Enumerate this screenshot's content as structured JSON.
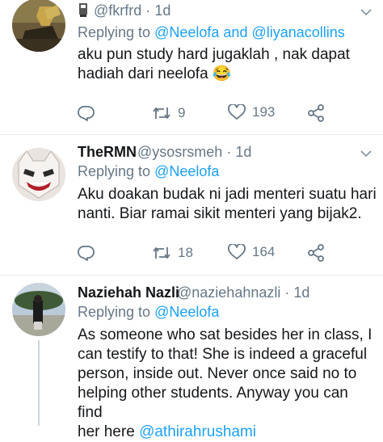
{
  "tweets": [
    {
      "name": "",
      "handle": "@fkrfrd",
      "time": "1d",
      "replying_prefix": "Replying to",
      "replying_mentions": [
        "@Neelofa",
        "@liyanacollins"
      ],
      "replying_joiner": "and",
      "body_lines": [
        "aku pun study hard jugaklah , nak dapat",
        "hadiah dari neelofa"
      ],
      "emoji": "😂",
      "replies": "",
      "retweets": "9",
      "likes": "193"
    },
    {
      "name": "TheRMN",
      "handle": "@ysosrsmeh",
      "time": "1d",
      "replying_prefix": "Replying to",
      "replying_mentions": [
        "@Neelofa"
      ],
      "body_lines": [
        "Aku doakan budak ni jadi menteri suatu hari",
        "nanti. Biar ramai sikit menteri yang bijak2."
      ],
      "replies": "",
      "retweets": "18",
      "likes": "164"
    },
    {
      "name": "Naziehah Nazli",
      "handle": "@naziehahnazli",
      "time": "1d",
      "replying_prefix": "Replying to",
      "replying_mentions": [
        "@Neelofa"
      ],
      "body_lines": [
        "As someone who sat besides her in class, I",
        "can testify to that! She is indeed a graceful",
        "person, inside out. Never once said no to",
        "helping other students. Anyway you can find",
        "her here"
      ],
      "body_mention": "@athirahrushami"
    }
  ],
  "separator": "·",
  "icons": [
    "reply-icon",
    "retweet-icon",
    "like-icon",
    "share-icon",
    "caret-down-icon"
  ],
  "colors": {
    "link": "#1da1f2",
    "muted": "#657786",
    "text": "#14171a"
  }
}
